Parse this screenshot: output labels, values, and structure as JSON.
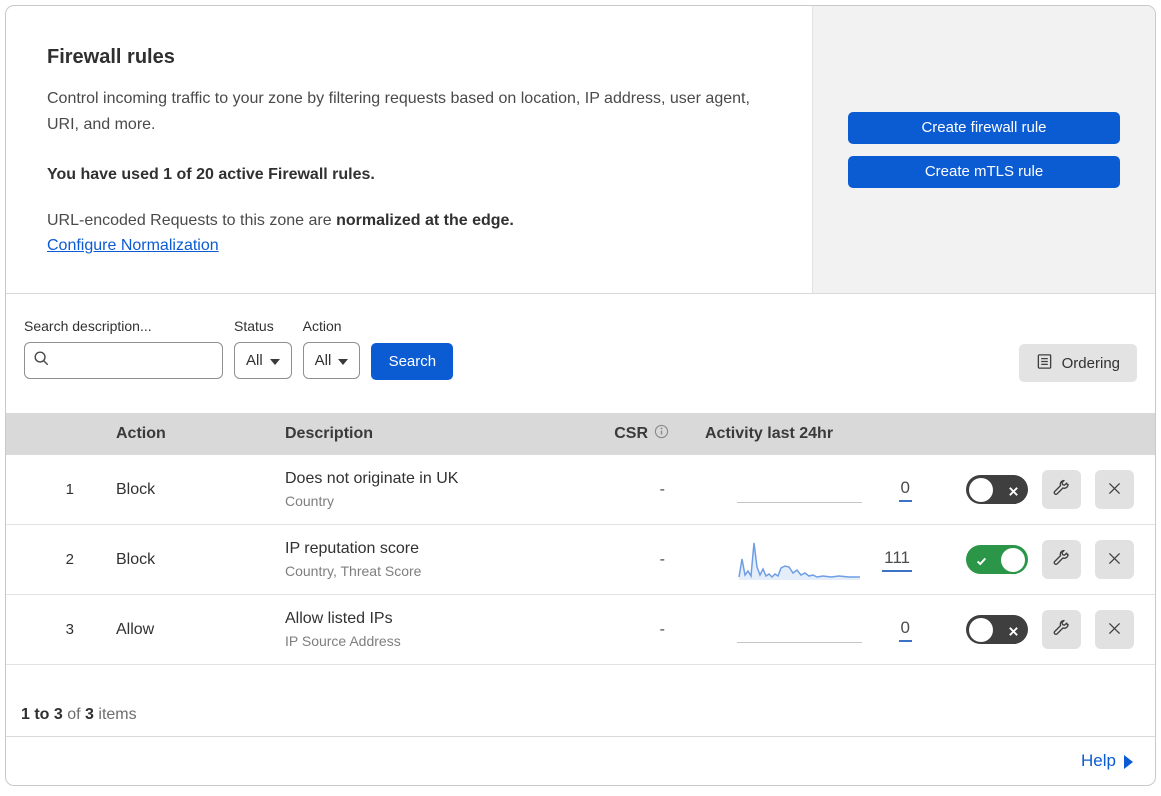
{
  "colors": {
    "accent_blue": "#0b5bd3",
    "toggle_on_green": "#2b9648",
    "toggle_off_gray": "#3f3f3f",
    "table_header_gray": "#d9d9d9",
    "panel_gray": "#f2f2f2",
    "sparkline_blue": "#6f9ee5"
  },
  "icons": {
    "search_icon": "magnifying-glass",
    "status_caret": "caret-down",
    "action_caret": "caret-down",
    "ordering_icon": "list-document",
    "csr_info_icon": "info-circle",
    "toggle_on_icon": "check",
    "toggle_off_icon": "cross",
    "wrench_icon": "wrench",
    "delete_icon": "x-cross",
    "help_arrow_icon": "triangle-right"
  },
  "header": {
    "title": "Firewall rules",
    "description": "Control incoming traffic to your zone by filtering requests based on location, IP address, user agent, URI, and more.",
    "usage_line": "You have used 1 of 20 active Firewall rules.",
    "normalization_prefix": "URL-encoded Requests to this zone are ",
    "normalization_bold": "normalized at the edge.",
    "normalization_link": "Configure Normalization",
    "create_firewall_button": "Create firewall rule",
    "create_mtls_button": "Create mTLS rule"
  },
  "filters": {
    "search_label": "Search description...",
    "search_value": "",
    "status_label": "Status",
    "status_value": "All",
    "action_label": "Action",
    "action_value": "All",
    "search_button": "Search",
    "ordering_button": "Ordering"
  },
  "table": {
    "columns": {
      "action": "Action",
      "description": "Description",
      "csr": "CSR",
      "activity": "Activity last 24hr"
    },
    "rows": [
      {
        "num": "1",
        "action": "Block",
        "description": "Does not originate in UK",
        "criteria": "Country",
        "csr": "-",
        "activity_count": "0",
        "enabled": false,
        "has_sparkline": false
      },
      {
        "num": "2",
        "action": "Block",
        "description": "IP reputation score",
        "criteria": "Country, Threat Score",
        "csr": "-",
        "activity_count": "111",
        "enabled": true,
        "has_sparkline": true
      },
      {
        "num": "3",
        "action": "Allow",
        "description": "Allow listed IPs",
        "criteria": "IP Source Address",
        "csr": "-",
        "activity_count": "0",
        "enabled": false,
        "has_sparkline": false
      }
    ]
  },
  "sparkline": {
    "width": 125,
    "height": 40,
    "points": [
      [
        2,
        37
      ],
      [
        5,
        19
      ],
      [
        8,
        35
      ],
      [
        11,
        31
      ],
      [
        14,
        36
      ],
      [
        17,
        3
      ],
      [
        20,
        27
      ],
      [
        23,
        35
      ],
      [
        26,
        29
      ],
      [
        29,
        36
      ],
      [
        32,
        34
      ],
      [
        35,
        37
      ],
      [
        38,
        34
      ],
      [
        41,
        36
      ],
      [
        44,
        28
      ],
      [
        48,
        26
      ],
      [
        52,
        27
      ],
      [
        56,
        33
      ],
      [
        60,
        30
      ],
      [
        64,
        35
      ],
      [
        68,
        33
      ],
      [
        72,
        36
      ],
      [
        76,
        35
      ],
      [
        80,
        37
      ],
      [
        86,
        36
      ],
      [
        94,
        37
      ],
      [
        102,
        36
      ],
      [
        112,
        37
      ],
      [
        123,
        37
      ]
    ]
  },
  "footer": {
    "range": "1 to 3",
    "of_text": "of",
    "total": "3",
    "items_text": "items",
    "help_label": "Help"
  }
}
